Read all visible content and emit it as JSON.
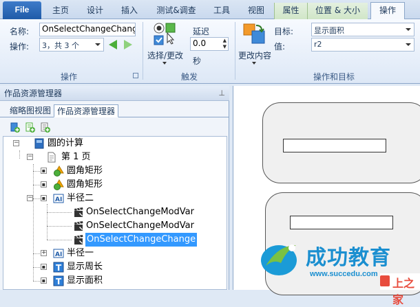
{
  "tabs": [
    {
      "label": "File"
    },
    {
      "label": "主页"
    },
    {
      "label": "设计"
    },
    {
      "label": "插入"
    },
    {
      "label": "测试&调查"
    },
    {
      "label": "工具"
    },
    {
      "label": "视图"
    },
    {
      "label": "属性"
    },
    {
      "label": "位置 & 大小"
    },
    {
      "label": "操作"
    }
  ],
  "ribbon": {
    "name_label": "名称:",
    "name_value": "OnSelectChangeChange",
    "action_label": "操作:",
    "action_value": "3，共 3 个",
    "group_action": "操作",
    "trigger_button": "选择/更改",
    "delay_label": "延迟",
    "delay_value": "0.0",
    "delay_unit": "秒",
    "group_trigger": "触发",
    "change_content_button": "更改内容",
    "target_label": "目标:",
    "target_value": "显示面积",
    "value_label": "值:",
    "value_value": "r2",
    "group_target": "操作和目标"
  },
  "pane": {
    "title": "作品资源管理器",
    "pin": "⊥",
    "subtabs": [
      {
        "label": "缩略图视图"
      },
      {
        "label": "作品资源管理器"
      }
    ],
    "tree": [
      {
        "label": "圆的计算"
      },
      {
        "label": "第 1 页"
      },
      {
        "label": "圆角矩形"
      },
      {
        "label": "圆角矩形"
      },
      {
        "label": "半径二"
      },
      {
        "label": "OnSelectChangeModVar"
      },
      {
        "label": "OnSelectChangeModVar"
      },
      {
        "label": "OnSelectChangeChange"
      },
      {
        "label": "半径一"
      },
      {
        "label": "显示周长"
      },
      {
        "label": "显示面积"
      }
    ]
  },
  "watermark": {
    "brand": "成功教育",
    "url": "www.succedu.com",
    "site": "上之家"
  }
}
